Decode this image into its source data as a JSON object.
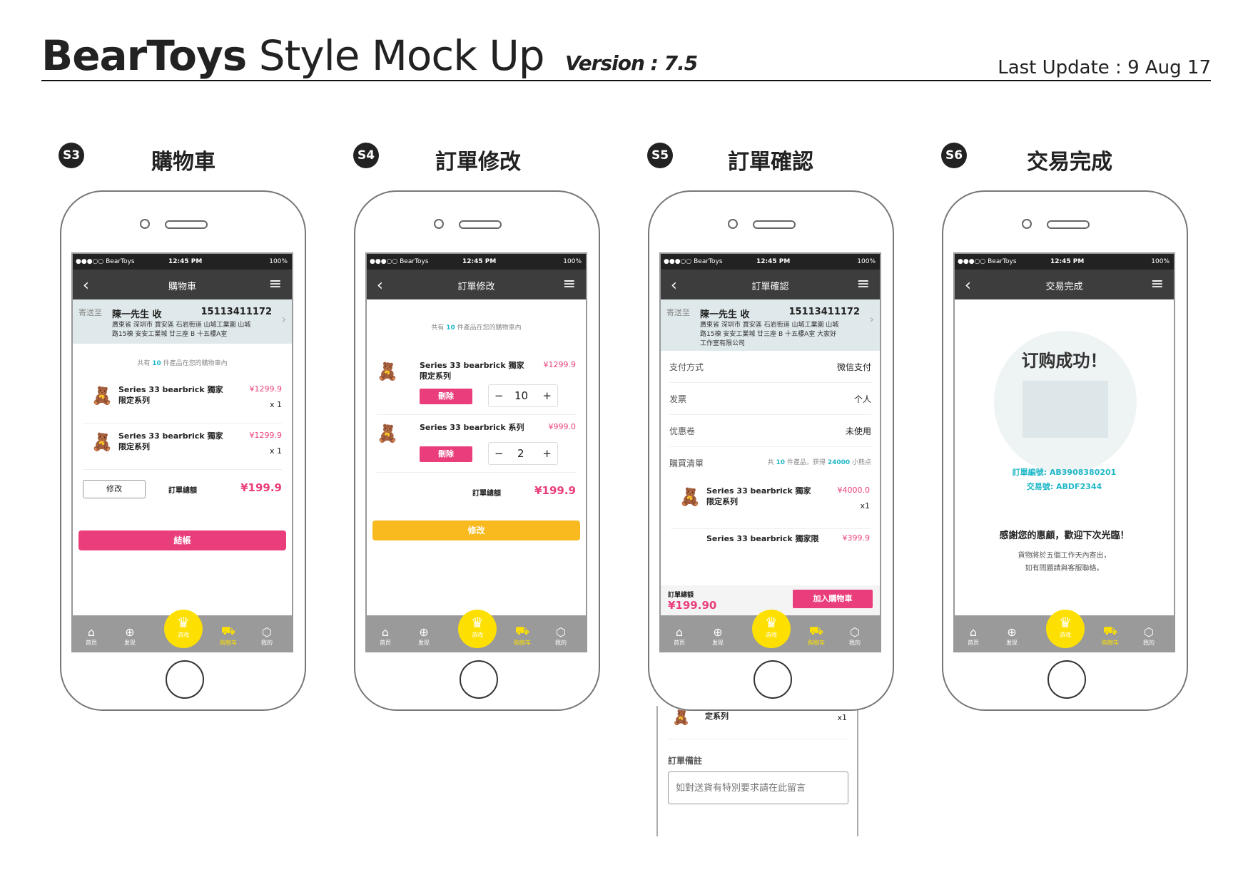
{
  "header": {
    "brand": "BearToys",
    "title_rest": "Style Mock Up",
    "version": "Version : 7.5",
    "last_update": "Last Update :   9 Aug 17"
  },
  "status": {
    "carrier": "●●●○○ BearToys",
    "time": "12:45 PM",
    "battery": "100%"
  },
  "tabs": {
    "home": "首页",
    "discover": "发现",
    "game": "游戏",
    "cart": "购物车",
    "mine": "我的"
  },
  "address": {
    "prefix": "寄送至",
    "name": "陳一先生 收",
    "phone": "15113411172",
    "line_a": "廣東省 深圳市 寶安區 石岩街道 山城工業園 山城路15棟 安安工業城 廿三座 B 十五樓A室",
    "line_b": "廣東省 深圳市 寶安區 石岩街道 山城工業園 山城路15棟 安安工業城 廿三座 B 十五樓A室 大家好工作室有限公司"
  },
  "count": {
    "pre": "共有 ",
    "n": "10",
    "post": " 件產品在您的購物車內"
  },
  "s3": {
    "badge": "S3",
    "title": "購物車",
    "nav": "購物車",
    "items": [
      {
        "name": "Series 33 bearbrick 獨家限定系列",
        "price": "¥1299.9",
        "qty": "x 1"
      },
      {
        "name": "Series 33 bearbrick 獨家限定系列",
        "price": "¥1299.9",
        "qty": "x 1"
      }
    ],
    "edit": "修改",
    "total_label": "訂單總額",
    "total": "¥199.9",
    "checkout": "結帳"
  },
  "s4": {
    "badge": "S4",
    "title": "訂單修改",
    "nav": "訂單修改",
    "items": [
      {
        "name": "Series 33 bearbrick 獨家限定系列",
        "price": "¥1299.9",
        "qty": "10"
      },
      {
        "name": "Series 33 bearbrick 系列",
        "price": "¥999.0",
        "qty": "2"
      }
    ],
    "delete": "刪除",
    "total_label": "訂單總額",
    "total": "¥199.9",
    "confirm": "修改"
  },
  "s5": {
    "badge": "S5",
    "title": "訂單確認",
    "nav": "訂單確認",
    "pay_label": "支付方式",
    "pay": "微信支付",
    "inv_label": "发票",
    "inv": "个人",
    "coupon_label": "优惠卷",
    "coupon": "未使用",
    "list_label": "購買清單",
    "list_pre": "共 ",
    "list_n": "10",
    "list_mid": " 件產品，获得 ",
    "list_pts": "24000",
    "list_post": " 小熊点",
    "item": {
      "name": "Series 33 bearbrick 獨家限定系列",
      "price": "¥4000.0",
      "qty": "x1"
    },
    "item2": {
      "name": "Series 33 bearbrick 獨家限",
      "price": "¥399.9"
    },
    "total_label": "訂單總額",
    "total": "¥199.90",
    "add": "加入購物車",
    "ext_item_tail": "定系列",
    "ext_qty": "x1",
    "note_label": "訂單備註",
    "note_placeholder": "如對送貨有特別要求請在此留言"
  },
  "s6": {
    "badge": "S6",
    "title": "交易完成",
    "nav": "交易完成",
    "success": "订购成功！",
    "order_no": "訂單編號: AB3908380201",
    "trade_no": "交易號: ABDF2344",
    "thanks": "感謝您的惠顧，歡迎下次光臨！",
    "msg1": "貨物將於五個工作天內寄出，",
    "msg2": "如有問題請與客服聯絡。"
  }
}
